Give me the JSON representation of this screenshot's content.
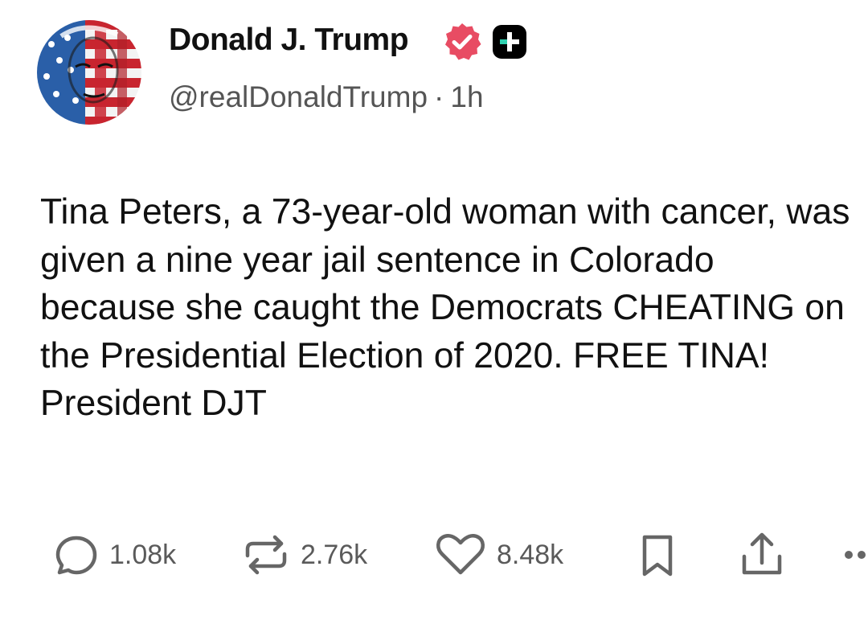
{
  "author": {
    "display_name": "Donald J. Trump",
    "handle": "@realDonaldTrump",
    "separator": "·",
    "time_ago": "1h",
    "verified_color": "#e84c63",
    "badge_color": "#000000"
  },
  "post": {
    "text": "Tina Peters, a 73-year-old woman with cancer, was given a nine year jail sentence in Colorado because she caught the Democrats CHEATING on the Presidential Election of 2020. FREE TINA! President DJT"
  },
  "actions": {
    "reply": {
      "icon": "comment-icon",
      "count": "1.08k"
    },
    "retruth": {
      "icon": "repost-icon",
      "count": "2.76k"
    },
    "like": {
      "icon": "heart-icon",
      "count": "8.48k"
    },
    "bookmark": {
      "icon": "bookmark-icon"
    },
    "share": {
      "icon": "share-icon"
    },
    "more": {
      "icon": "more-icon"
    }
  }
}
